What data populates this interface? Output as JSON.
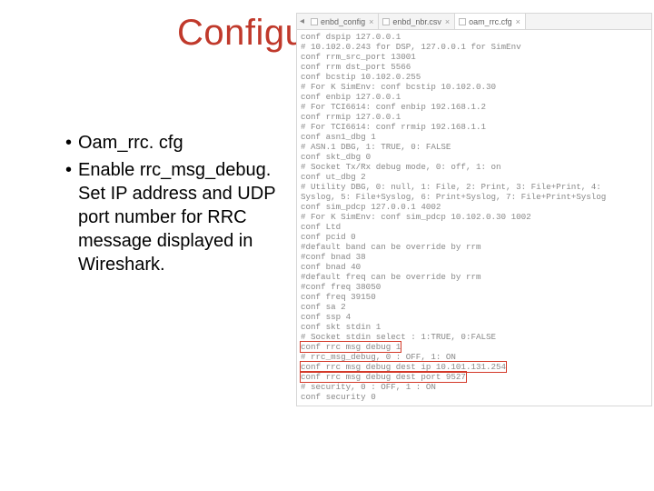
{
  "title": "Configu",
  "bullets": [
    "Oam_rrc. cfg",
    "Enable rrc_msg_debug. Set IP address and UDP port number for RRC message displayed in Wireshark."
  ],
  "tabs": [
    {
      "label": "enbd_config"
    },
    {
      "label": "enbd_nbr.csv"
    },
    {
      "label": "oam_rrc.cfg",
      "active": true
    }
  ],
  "code": [
    "conf dspip 127.0.0.1",
    "# 10.102.0.243 for DSP, 127.0.0.1 for SimEnv",
    "conf rrm_src_port 13001",
    "conf rrm dst_port 5566",
    "conf bcstip 10.102.0.255",
    "# For K SimEnv: conf bcstip 10.102.0.30",
    "conf enbip 127.0.0.1",
    "# For TCI6614: conf enbip 192.168.1.2",
    "conf rrmip 127.0.0.1",
    "# For TCI6614: conf rrmip 192.168.1.1",
    "conf asn1_dbg 1",
    "# ASN.1 DBG, 1: TRUE, 0: FALSE",
    "conf skt_dbg 0",
    "# Socket Tx/Rx debug mode, 0: off, 1: on",
    "conf ut_dbg 2",
    "# Utility DBG, 0: null, 1: File, 2: Print, 3: File+Print, 4:",
    "Syslog, 5: File+Syslog, 6: Print+Syslog, 7: File+Print+Syslog",
    "conf sim_pdcp 127.0.0.1 4002",
    "# For K SimEnv: conf sim_pdcp 10.102.0.30 1002",
    "conf Ltd",
    "conf pcid 0",
    "#default band can be override by rrm",
    "#conf bnad 38",
    "conf bnad 40",
    "#default freq can be override by rrm",
    "#conf freq 38050",
    "conf freq 39150",
    "conf sa 2",
    "conf ssp 4",
    "conf skt stdin 1",
    "# Socket stdin select : 1:TRUE, 0:FALSE",
    "conf rrc msg debug 1",
    "# rrc_msg_debug, 0 : OFF, 1: ON",
    "conf rrc msg debug dest ip 10.101.131.254",
    "conf rrc msg debug dest port 9527",
    "# security, 0 : OFF, 1 : ON",
    "conf security 0"
  ],
  "hl_idx": [
    31,
    33,
    34
  ]
}
